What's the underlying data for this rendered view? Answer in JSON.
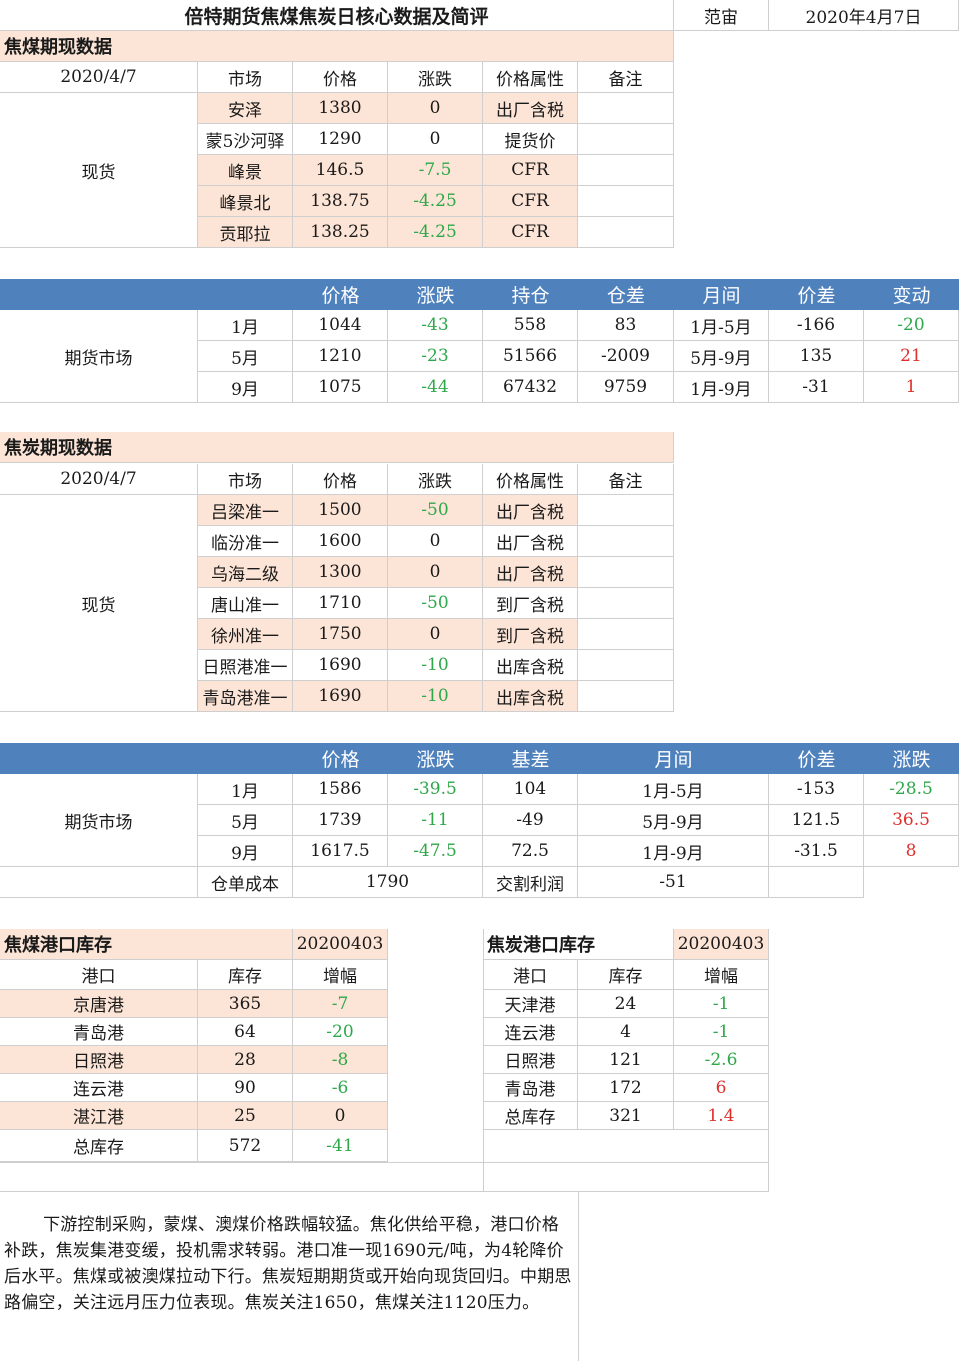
{
  "header": {
    "title": "倍特期货焦煤焦炭日核心数据及简评",
    "author": "范宙",
    "date": "2020年4月7日"
  },
  "coking_coal_spot": {
    "section_title": "焦煤期现数据",
    "date": "2020/4/7",
    "columns": [
      "市场",
      "价格",
      "涨跌",
      "价格属性",
      "备注"
    ],
    "row_group_label": "现货",
    "rows": [
      {
        "market": "安泽",
        "price": "1380",
        "change": "0",
        "attr": "出厂含税",
        "note": ""
      },
      {
        "market": "蒙5沙河驿",
        "price": "1290",
        "change": "0",
        "attr": "提货价",
        "note": ""
      },
      {
        "market": "峰景",
        "price": "146.5",
        "change": "-7.5",
        "attr": "CFR",
        "note": ""
      },
      {
        "market": "峰景北",
        "price": "138.75",
        "change": "-4.25",
        "attr": "CFR",
        "note": ""
      },
      {
        "market": "贡耶拉",
        "price": "138.25",
        "change": "-4.25",
        "attr": "CFR",
        "note": ""
      }
    ]
  },
  "coking_coal_futures": {
    "columns": [
      "价格",
      "涨跌",
      "持仓",
      "仓差",
      "月间",
      "价差",
      "变动"
    ],
    "row_group_label": "期货市场",
    "rows": [
      {
        "month": "1月",
        "price": "1044",
        "change": "-43",
        "oi": "558",
        "oi_change": "83",
        "spread_name": "1月-5月",
        "spread": "-166",
        "spread_change": "-20"
      },
      {
        "month": "5月",
        "price": "1210",
        "change": "-23",
        "oi": "51566",
        "oi_change": "-2009",
        "spread_name": "5月-9月",
        "spread": "135",
        "spread_change": "21"
      },
      {
        "month": "9月",
        "price": "1075",
        "change": "-44",
        "oi": "67432",
        "oi_change": "9759",
        "spread_name": "1月-9月",
        "spread": "-31",
        "spread_change": "1"
      }
    ]
  },
  "coke_spot": {
    "section_title": "焦炭期现数据",
    "date": "2020/4/7",
    "columns": [
      "市场",
      "价格",
      "涨跌",
      "价格属性",
      "备注"
    ],
    "row_group_label": "现货",
    "rows": [
      {
        "market": "吕梁准一",
        "price": "1500",
        "change": "-50",
        "attr": "出厂含税",
        "note": ""
      },
      {
        "market": "临汾准一",
        "price": "1600",
        "change": "0",
        "attr": "出厂含税",
        "note": ""
      },
      {
        "market": "乌海二级",
        "price": "1300",
        "change": "0",
        "attr": "出厂含税",
        "note": ""
      },
      {
        "market": "唐山准一",
        "price": "1710",
        "change": "-50",
        "attr": "到厂含税",
        "note": ""
      },
      {
        "market": "徐州准一",
        "price": "1750",
        "change": "0",
        "attr": "到厂含税",
        "note": ""
      },
      {
        "market": "日照港准一",
        "price": "1690",
        "change": "-10",
        "attr": "出库含税",
        "note": ""
      },
      {
        "market": "青岛港准一",
        "price": "1690",
        "change": "-10",
        "attr": "出库含税",
        "note": ""
      }
    ]
  },
  "coke_futures": {
    "columns": [
      "价格",
      "涨跌",
      "基差",
      "月间",
      "价差",
      "涨跌"
    ],
    "row_group_label": "期货市场",
    "rows": [
      {
        "month": "1月",
        "price": "1586",
        "change": "-39.5",
        "basis": "104",
        "spread_name": "1月-5月",
        "spread": "-153",
        "spread_change": "-28.5"
      },
      {
        "month": "5月",
        "price": "1739",
        "change": "-11",
        "basis": "-49",
        "spread_name": "5月-9月",
        "spread": "121.5",
        "spread_change": "36.5"
      },
      {
        "month": "9月",
        "price": "1617.5",
        "change": "-47.5",
        "basis": "72.5",
        "spread_name": "1月-9月",
        "spread": "-31.5",
        "spread_change": "8"
      }
    ],
    "warrant_cost_label": "仓单成本",
    "warrant_cost": "1790",
    "delivery_profit_label": "交割利润",
    "delivery_profit": "-51"
  },
  "coal_port_stock": {
    "title": "焦煤港口库存",
    "date": "20200403",
    "columns": [
      "港口",
      "库存",
      "增幅"
    ],
    "rows": [
      {
        "port": "京唐港",
        "stock": "365",
        "change": "-7"
      },
      {
        "port": "青岛港",
        "stock": "64",
        "change": "-20"
      },
      {
        "port": "日照港",
        "stock": "28",
        "change": "-8"
      },
      {
        "port": "连云港",
        "stock": "90",
        "change": "-6"
      },
      {
        "port": "湛江港",
        "stock": "25",
        "change": "0"
      },
      {
        "port": "总库存",
        "stock": "572",
        "change": "-41"
      }
    ]
  },
  "coke_port_stock": {
    "title": "焦炭港口库存",
    "date": "20200403",
    "columns": [
      "港口",
      "库存",
      "增幅"
    ],
    "rows": [
      {
        "port": "天津港",
        "stock": "24",
        "change": "-1"
      },
      {
        "port": "连云港",
        "stock": "4",
        "change": "-1"
      },
      {
        "port": "日照港",
        "stock": "121",
        "change": "-2.6"
      },
      {
        "port": "青岛港",
        "stock": "172",
        "change": "6"
      },
      {
        "port": "总库存",
        "stock": "321",
        "change": "1.4"
      }
    ]
  },
  "commentary": "下游控制采购，蒙煤、澳煤价格跌幅较猛。焦化供给平稳，港口价格补跌，焦炭集港变缓，投机需求转弱。港口准一现1690元/吨，为4轮降价后水平。焦煤或被澳煤拉动下行。焦炭短期期货或开始向现货回归。中期思路偏空，关注远月压力位表现。焦炭关注1650，焦煤关注1120压力。",
  "colors": {
    "peach": "#fce4d6",
    "header_blue": "#4f81bd",
    "down_green": "#2ea84a",
    "up_red": "#e0302e"
  }
}
